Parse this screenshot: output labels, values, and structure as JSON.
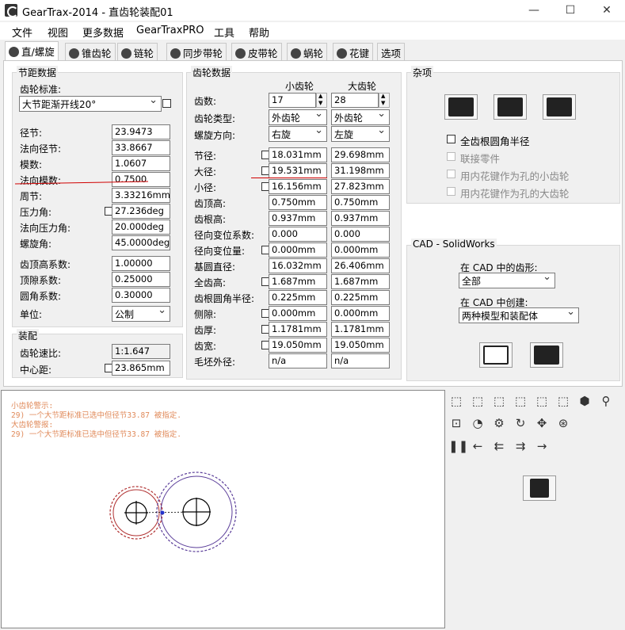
{
  "window": {
    "title": "GearTrax-2014 - 直齿轮装配01",
    "minimize": "—",
    "maximize": "☐",
    "close": "✕"
  },
  "menu": [
    "文件",
    "视图",
    "更多数据",
    "GearTraxPRO",
    "工具",
    "帮助"
  ],
  "tabs": [
    {
      "label": "直/螺旋",
      "icon": "spur-gear-icon"
    },
    {
      "label": "锥齿轮",
      "icon": "bevel-gear-icon"
    },
    {
      "label": "链轮",
      "icon": "sprocket-icon"
    },
    {
      "label": "同步带轮",
      "icon": "timing-pulley-icon"
    },
    {
      "label": "皮带轮",
      "icon": "belt-pulley-icon"
    },
    {
      "label": "蜗轮",
      "icon": "worm-icon"
    },
    {
      "label": "花键",
      "icon": "spline-icon"
    },
    {
      "label": "选项",
      "icon": ""
    }
  ],
  "pitch": {
    "title": "节距数据",
    "standard_label": "齿轮标准:",
    "standard_value": "大节距渐开线20°",
    "rows": [
      {
        "label": "径节:",
        "value": "23.9473"
      },
      {
        "label": "法向径节:",
        "value": "33.8667"
      },
      {
        "label": "模数:",
        "value": "1.0607"
      },
      {
        "label": "法向模数:",
        "value": "0.7500"
      },
      {
        "label": "周节:",
        "value": "3.33216mm"
      },
      {
        "label": "压力角:",
        "value": "27.236deg"
      },
      {
        "label": "法向压力角:",
        "value": "20.000deg"
      },
      {
        "label": "螺旋角:",
        "value": "45.0000deg"
      }
    ],
    "coef_rows": [
      {
        "label": "齿顶高系数:",
        "value": "1.00000"
      },
      {
        "label": "顶隙系数:",
        "value": "0.25000"
      },
      {
        "label": "圆角系数:",
        "value": "0.30000"
      }
    ],
    "unit_label": "单位:",
    "unit_value": "公制"
  },
  "assembly": {
    "title": "装配",
    "ratio_label": "齿轮速比:",
    "ratio_value": "1:1.647",
    "center_label": "中心距:",
    "center_value": "23.865mm"
  },
  "gear": {
    "title": "齿轮数据",
    "col_small": "小齿轮",
    "col_large": "大齿轮",
    "teeth_label": "齿数:",
    "teeth_small": "17",
    "teeth_large": "28",
    "type_label": "齿轮类型:",
    "type_small": "外齿轮",
    "type_large": "外齿轮",
    "helix_label": "螺旋方向:",
    "helix_small": "右旋",
    "helix_large": "左旋",
    "rows": [
      {
        "label": "节径:",
        "small": "18.031mm",
        "large": "29.698mm",
        "chk": true
      },
      {
        "label": "大径:",
        "small": "19.531mm",
        "large": "31.198mm",
        "chk": true
      },
      {
        "label": "小径:",
        "small": "16.156mm",
        "large": "27.823mm",
        "chk": true
      },
      {
        "label": "齿顶高:",
        "small": "0.750mm",
        "large": "0.750mm",
        "chk": false
      },
      {
        "label": "齿根高:",
        "small": "0.937mm",
        "large": "0.937mm",
        "chk": false
      },
      {
        "label": "径向变位系数:",
        "small": "0.000",
        "large": "0.000",
        "chk": false
      },
      {
        "label": "径向变位量:",
        "small": "0.000mm",
        "large": "0.000mm",
        "chk": true
      },
      {
        "label": "基圆直径:",
        "small": "16.032mm",
        "large": "26.406mm",
        "chk": false
      },
      {
        "label": "全齿高:",
        "small": "1.687mm",
        "large": "1.687mm",
        "chk": true
      },
      {
        "label": "齿根圆角半径:",
        "small": "0.225mm",
        "large": "0.225mm",
        "chk": false
      },
      {
        "label": "侧隙:",
        "small": "0.000mm",
        "large": "0.000mm",
        "chk": true
      },
      {
        "label": "齿厚:",
        "small": "1.1781mm",
        "large": "1.1781mm",
        "chk": true
      },
      {
        "label": "齿宽:",
        "small": "19.050mm",
        "large": "19.050mm",
        "chk": true
      },
      {
        "label": "毛坯外径:",
        "small": "n/a",
        "large": "n/a",
        "chk": false
      }
    ]
  },
  "misc": {
    "title": "杂项",
    "buttons": [
      "gear-wheel-icon",
      "balance-scale-icon",
      "caliper-icon"
    ],
    "checks": [
      {
        "label": "全齿根圆角半径",
        "enabled": true
      },
      {
        "label": "联接零件",
        "enabled": false
      },
      {
        "label": "用内花键作为孔的小齿轮",
        "enabled": false
      },
      {
        "label": "用内花键作为孔的大齿轮",
        "enabled": false
      }
    ]
  },
  "cad": {
    "title": "CAD - SolidWorks",
    "shape_label": "在 CAD 中的齿形:",
    "shape_value": "全部",
    "create_label": "在 CAD 中创建:",
    "create_value": "两种模型和装配体"
  },
  "console": {
    "lines": [
      "小齿轮警示:",
      "  29) 一个大节距标准已选中但径节33.87 被指定.",
      "大齿轮警报:",
      "  29) 一个大节距标准已选中但径节33.87 被指定."
    ]
  },
  "colors": {
    "warning_text": "#e08a5a",
    "small_gear": "#b03030",
    "large_gear": "#5a3d99",
    "red_line": "#d00000"
  }
}
